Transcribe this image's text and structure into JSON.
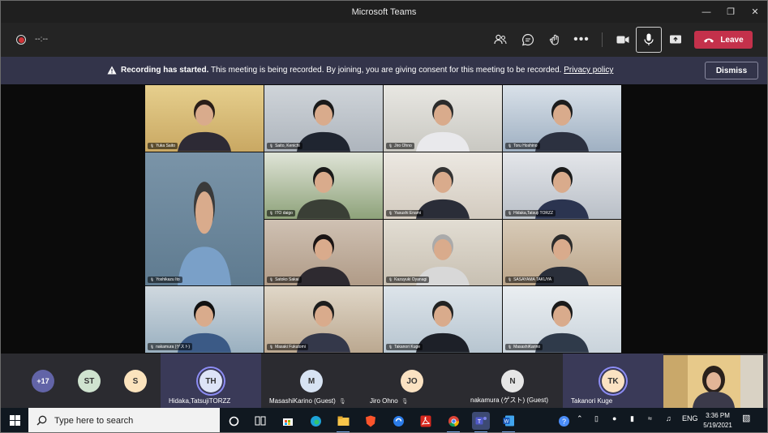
{
  "window": {
    "title": "Microsoft Teams"
  },
  "toolbar": {
    "timer": "--:--",
    "leave_label": "Leave"
  },
  "banner": {
    "title": "Recording has started.",
    "message": "This meeting is being recorded. By joining, you are giving consent for this meeting to be recorded.",
    "link": "Privacy policy",
    "dismiss_label": "Dismiss"
  },
  "tiles": [
    {
      "name": "Yuka Saito"
    },
    {
      "name": "Saito, Kenichi"
    },
    {
      "name": "Jiro Ohno"
    },
    {
      "name": "Toru Hoshino"
    },
    {
      "name": "ITO daigo"
    },
    {
      "name": "Yasushi Enami"
    },
    {
      "name": "Hidaka,Tatsuji TORZZ"
    },
    {
      "name": "Yoshikazu Ito"
    },
    {
      "name": "Satoko Sakai"
    },
    {
      "name": "Kazuyuki Oyanagi"
    },
    {
      "name": "SASAYAMA TAKUYA"
    },
    {
      "name": "nakamura (ゲスト)"
    },
    {
      "name": "Masaki Fukutomi"
    },
    {
      "name": "Takanori Kuge"
    },
    {
      "name": "MasashiKarino"
    }
  ],
  "participants": {
    "overflow": "+17",
    "avatars": [
      {
        "initials": "ST",
        "color": "#cfe3cf"
      },
      {
        "initials": "S",
        "color": "#fbe3bd"
      }
    ],
    "slots": [
      {
        "initials": "TH",
        "name": "Hidaka,TatsujiTORZZ",
        "color": "#dde4f7",
        "active": true
      },
      {
        "initials": "M",
        "name": "MasashiKarino (Guest)",
        "color": "#d7e3f3",
        "active": false
      },
      {
        "initials": "JO",
        "name": "Jiro Ohno",
        "color": "#fbe2c2",
        "active": false
      },
      {
        "initials": "N",
        "name": "nakamura (ゲスト) (Guest)",
        "color": "#e6e6e6",
        "active": false
      },
      {
        "initials": "TK",
        "name": "Takanori Kuge",
        "color": "#fbe2c2",
        "active": true
      }
    ]
  },
  "taskbar": {
    "search_placeholder": "Type here to search",
    "lang": "ENG",
    "time": "3:36 PM",
    "date": "5/19/2021"
  },
  "colors": {
    "accent": "#6264a7",
    "leave": "#c4314b",
    "banner": "#33344a"
  }
}
